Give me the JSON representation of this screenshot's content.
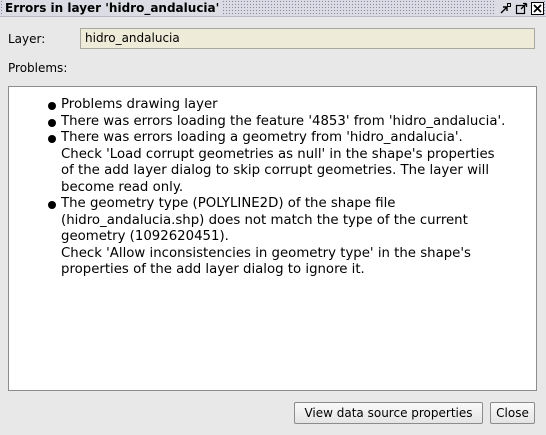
{
  "window": {
    "title": "Errors in layer 'hidro_andalucia'"
  },
  "titlebar_icons": [
    "restore-icon",
    "maximize-icon",
    "close-icon"
  ],
  "layer": {
    "label": "Layer:",
    "value": "hidro_andalucia"
  },
  "problems": {
    "label": "Problems:",
    "items": [
      {
        "lines": [
          "Problems drawing layer"
        ]
      },
      {
        "lines": [
          "There was errors loading the feature '4853' from 'hidro_andalucia'."
        ]
      },
      {
        "lines": [
          "There was errors loading a geometry from 'hidro_andalucia'.",
          "Check 'Load corrupt geometries as null' in the shape's properties",
          "of the add layer dialog to skip corrupt geometries. The layer will",
          "become read only."
        ]
      },
      {
        "lines": [
          "The geometry type (POLYLINE2D) of the shape file",
          "(hidro_andalucia.shp) does not match the type of the current",
          "geometry (1092620451).",
          "Check 'Allow inconsistencies in geometry type' in the shape's",
          "properties of the add layer dialog to ignore it."
        ]
      }
    ]
  },
  "buttons": {
    "view_label": "View data source properties",
    "close_label": "Close"
  }
}
